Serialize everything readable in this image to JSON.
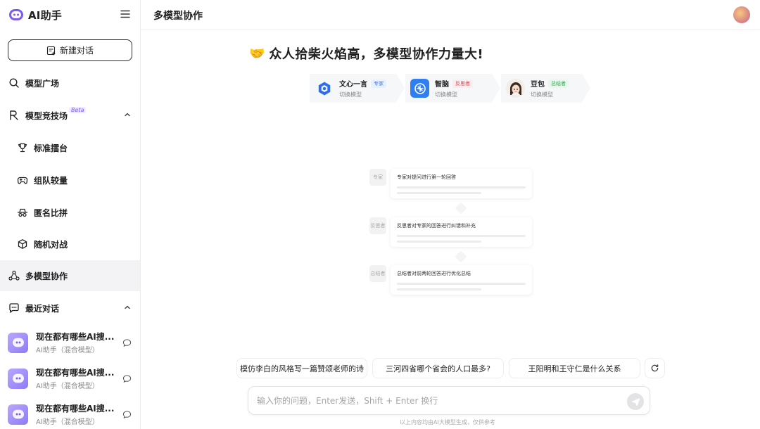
{
  "app": {
    "name": "AI助手"
  },
  "sidebar": {
    "new_chat_label": "新建对话",
    "nav": [
      {
        "label": "模型广场",
        "icon": "search-icon"
      },
      {
        "label": "模型竞技场",
        "icon": "arena-icon",
        "badge": "Beta",
        "expanded": true
      },
      {
        "label": "标准擂台",
        "icon": "trophy-icon"
      },
      {
        "label": "组队较量",
        "icon": "gamepad-icon"
      },
      {
        "label": "匿名比拼",
        "icon": "incognito-icon"
      },
      {
        "label": "随机对战",
        "icon": "cube-icon"
      },
      {
        "label": "多模型协作",
        "icon": "collab-icon",
        "active": true
      },
      {
        "label": "最近对话",
        "icon": "chat-icon",
        "expanded": true
      }
    ],
    "recent": [
      {
        "title": "现在都有哪些AI搜...",
        "subtitle": "AI助手（混合模型）"
      },
      {
        "title": "现在都有哪些AI搜...",
        "subtitle": "AI助手（混合模型）"
      },
      {
        "title": "现在都有哪些AI搜...",
        "subtitle": "AI助手（混合模型）"
      }
    ]
  },
  "header": {
    "title": "多模型协作"
  },
  "hero": {
    "emoji": "🤝",
    "text": "众人拾柴火焰高，多模型协作力量大!"
  },
  "models": [
    {
      "name": "文心一言",
      "role": "专家",
      "action": "切换模型",
      "role_color": "#3b7cf0",
      "role_bg": "#e7f0ff"
    },
    {
      "name": "智脑",
      "role": "反思者",
      "action": "切换模型",
      "role_color": "#e5484d",
      "role_bg": "#fdecee"
    },
    {
      "name": "豆包",
      "role": "总结者",
      "action": "切换模型",
      "role_color": "#2fa84f",
      "role_bg": "#e8f7ec"
    }
  ],
  "flow": [
    {
      "role": "专家",
      "text": "专家对提问进行第一轮回答"
    },
    {
      "role": "反思者",
      "text": "反思者对专家的回答进行纠错和补充"
    },
    {
      "role": "总结者",
      "text": "总结者对前两轮回答进行优化总结"
    }
  ],
  "suggestions": [
    "模仿李白的风格写一篇赞颂老师的诗",
    "三河四省哪个省会的人口最多?",
    "王阳明和王守仁是什么关系"
  ],
  "input": {
    "placeholder": "输入你的问题，Enter发送，Shift + Enter 换行"
  },
  "disclaimer": "以上内容均由AI大模型生成，仅供参考",
  "colors": {
    "accent": "#7a5cf0",
    "active_bg": "#f3f3f5"
  }
}
